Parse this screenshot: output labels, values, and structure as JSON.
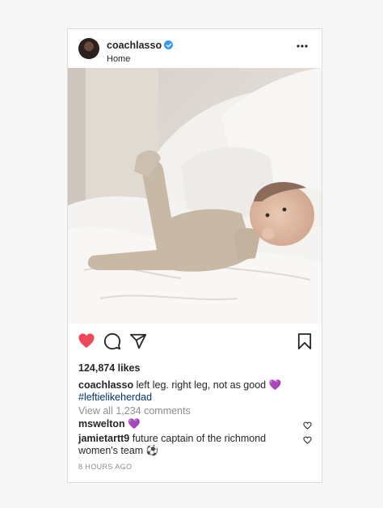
{
  "post": {
    "username": "coachlasso",
    "location": "Home",
    "likes": "124,874 likes",
    "caption_username": "coachlasso",
    "caption_text": "left leg. right leg, not as good",
    "caption_emoji": "💜",
    "hashtag": "#leftielikeherdad",
    "view_all": "View all 1,234 comments",
    "comments": [
      {
        "username": "mswelton",
        "text": "💜"
      },
      {
        "username": "jamietartt9",
        "text": "future captain of the richmond women's team ⚽"
      }
    ],
    "time": "8 HOURS AGO"
  },
  "icons": {
    "verified": "verified-badge-icon",
    "more": "more-options-icon",
    "like": "heart-filled-icon",
    "comment": "comment-bubble-icon",
    "share": "paper-plane-icon",
    "save": "bookmark-icon",
    "comment_like": "heart-outline-icon"
  },
  "colors": {
    "like_red": "#ed4956",
    "verified_blue": "#3897f0",
    "hashtag": "#003569",
    "muted": "#8e8e8e"
  }
}
